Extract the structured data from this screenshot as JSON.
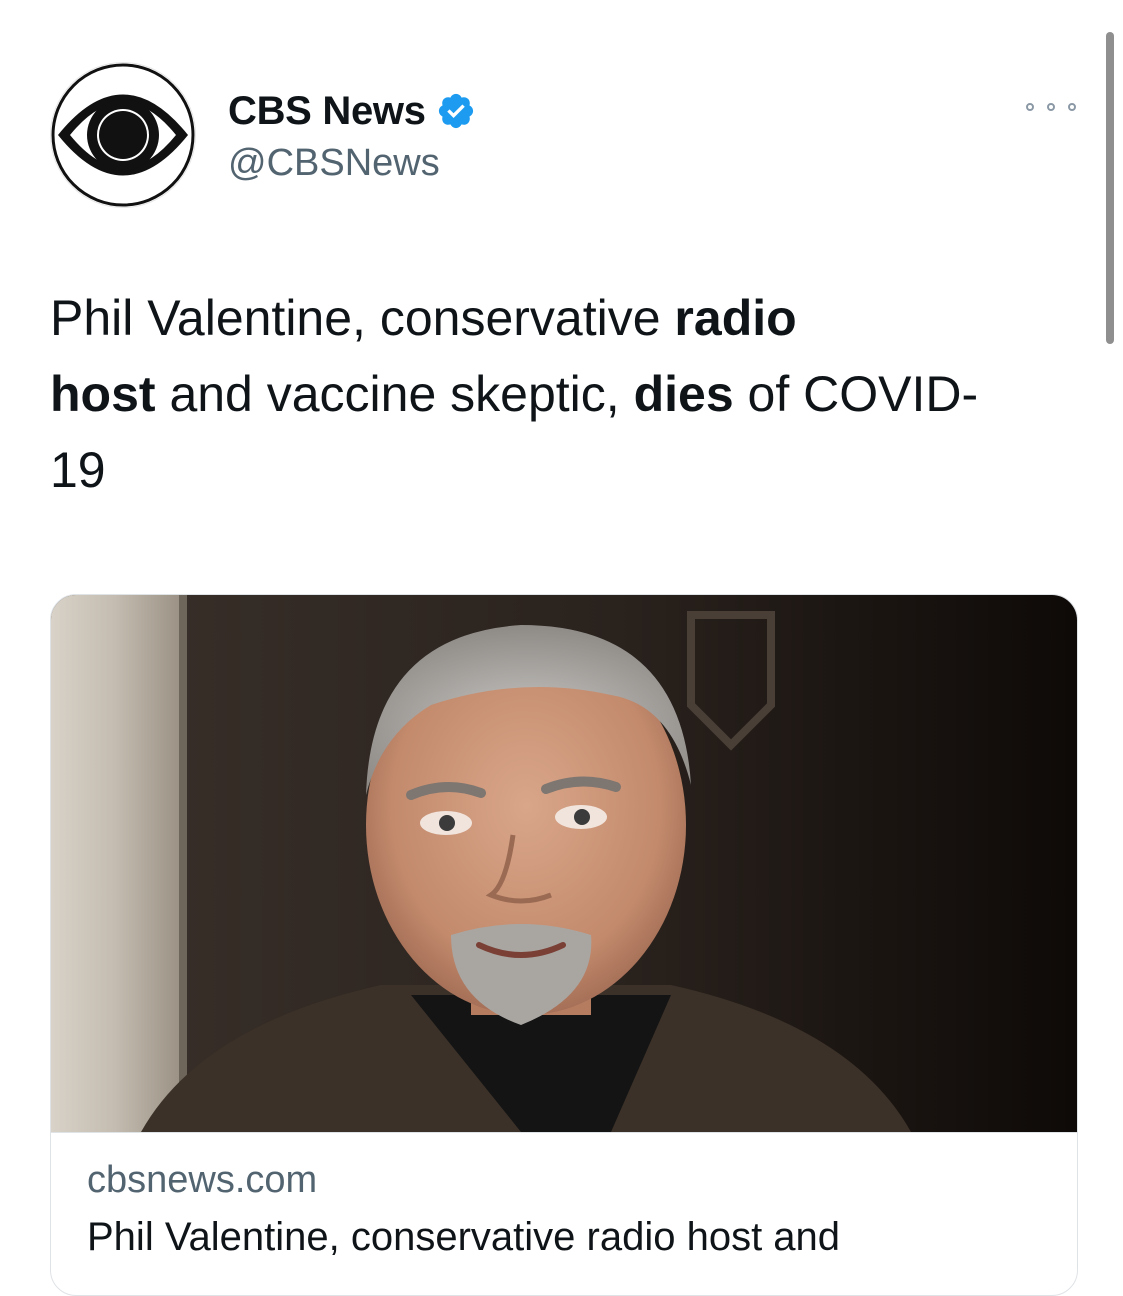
{
  "tweet": {
    "author": {
      "name": "CBS News",
      "handle": "@CBSNews",
      "verified": true,
      "avatar_icon": "cbs-eye-logo-icon"
    },
    "more_icon": "more-horizontal-icon",
    "text_segments": [
      {
        "text": "Phil Valentine, conservative ",
        "bold": false
      },
      {
        "text": "radio",
        "bold": true
      },
      {
        "text": " ",
        "bold": false
      },
      {
        "text": "host",
        "bold": true
      },
      {
        "text": " and vaccine skeptic, ",
        "bold": false
      },
      {
        "text": "dies",
        "bold": true
      },
      {
        "text": " of COVID-19",
        "bold": false
      }
    ],
    "card": {
      "domain": "cbsnews.com",
      "title": "Phil Valentine, conservative radio host and",
      "image_alt": "Portrait photo of Phil Valentine"
    }
  },
  "colors": {
    "text_primary": "#0f1419",
    "text_secondary": "#536471",
    "verified_blue": "#1d9bf0",
    "border": "#dfe3e6"
  }
}
